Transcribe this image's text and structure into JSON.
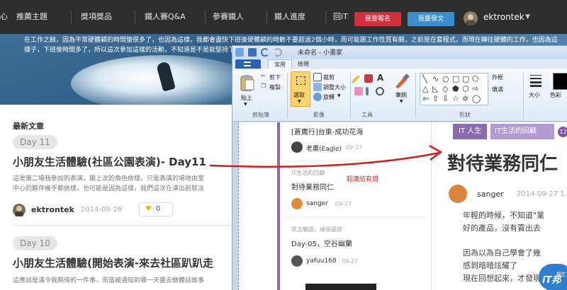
{
  "nav": {
    "items": [
      "心",
      "推薦主題",
      "獎項獎品",
      "鐵人賽Q&A",
      "參賽鐵人",
      "鐵人進度",
      "回iT邦幫忙"
    ],
    "signup_label": "我要報名",
    "post_label": "我要發文",
    "username": "ektrontek",
    "caret": "▼"
  },
  "hero": {
    "text": "在工作之餘，因為平常硬體顧的時間蠻很多了，也因為這樣，我都會盡快下班後硬體顧的時數不要超過2個小時，而可能跟工作性質有關，之前是在套程式，而現在轉往硬體的工作，也因為這樣子，下班後時間多了，所以這次參加這樣的活動，不知道是不是能堅持下去，相信可以做吧？就讓我們繼續看下去"
  },
  "list": {
    "section_title": "最新文章",
    "articles": [
      {
        "day": "Day 11",
        "title": "小朋友生活體驗(社區公園表演)- Day11",
        "excerpt_1": "這是第二場我參加的表演，跟上次的角色依樣，只是表演的場地由室",
        "excerpt_2": "中心的夥伴幾乎都依樣，也可能是因為這樣，我們這次在演出前就淡",
        "author": "ektrontek",
        "date": "2014-09-26",
        "likes": "0"
      },
      {
        "day": "Day 10",
        "title": "小朋友生活體驗(開始表演-來去社區趴趴走",
        "excerpt_1": "這應該是滿令我期待的一件事，而當被通知到哪一天要去做體話故事",
        "excerpt_2": ""
      }
    ]
  },
  "paint": {
    "title": "未命名 - 小畫家",
    "tabs": [
      "常用",
      "檢視"
    ],
    "clipboard": {
      "paste": "貼上",
      "paste_caret": "▼",
      "cut": "剪下",
      "copy": "複製",
      "label": "剪貼簿"
    },
    "image": {
      "select": "選取",
      "select_caret": "▼",
      "crop": "裁剪",
      "resize": "調整大小",
      "rotate": "旋轉",
      "rotate_caret": "▼",
      "label": "影像"
    },
    "tools": {
      "label": "工具",
      "brush": "筆刷",
      "brush_caret": "▼"
    },
    "shapes": {
      "label": "形狀",
      "outline": "外框",
      "fill": "填滿",
      "size": "大小",
      "color": "色彩"
    },
    "canvas": {
      "posts": [
        {
          "related": "",
          "title": "[蒼鷹行]台東-成功花海",
          "author": "老鷹(Eagle)",
          "date": "09-27"
        },
        {
          "related": "IT生活的回顧",
          "title": "對待業務同仁",
          "author": "sanger",
          "date": "09-27"
        },
        {
          "related": "花言雜語，緣來是妳",
          "title": "Day-05，空谷幽蘭",
          "author": "yafuu168",
          "date": "09-27"
        }
      ],
      "red_note": "超連結有錯",
      "tag_main": "IT 人生",
      "tag_sub": "IT生活的回顧",
      "tag_count": "12",
      "article_title": "對待業務同仁",
      "article_author": "sanger",
      "article_date": "2014-09-27 1",
      "body_1": "年輕的時候，不知道\"業",
      "body_2": "好的產品，沒有賣出去",
      "body_3": "因為以為自己學會了幾",
      "body_4": "感到暗暗炫耀了",
      "body_5": "現在回想起來，才發現"
    },
    "logo": {
      "it": "iT邦",
      "sub": "幫忙"
    }
  },
  "colors": {
    "nav_bg": "#2d2d2d",
    "signup": "#d2303a",
    "post": "#3a8fd0",
    "purple": "#8c6bb1",
    "arrow": "#cc2020"
  },
  "icons": [
    "scissors-icon",
    "copy-icon",
    "clipboard-icon",
    "select-icon",
    "crop-icon",
    "resize-icon",
    "rotate-icon",
    "pencil-icon",
    "fill-icon",
    "text-icon",
    "eraser-icon",
    "picker-icon",
    "magnifier-icon",
    "brush-icon",
    "heart-icon",
    "save-icon",
    "undo-icon",
    "redo-icon"
  ]
}
